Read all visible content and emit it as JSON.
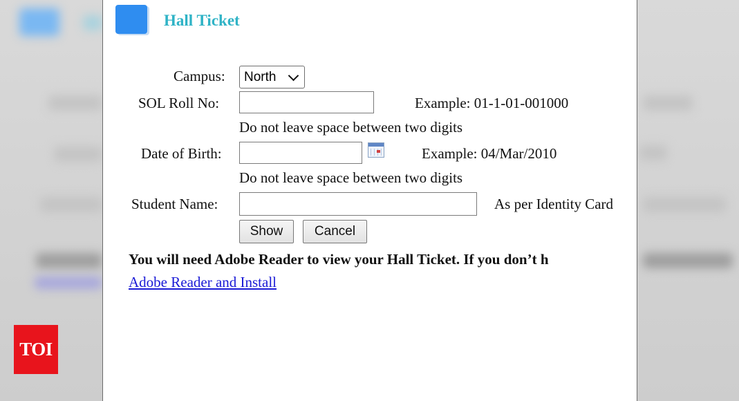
{
  "page": {
    "title": "Hall Ticket",
    "accent_color": "#2fb3c6",
    "icon_color": "#2f8df0"
  },
  "form": {
    "campus": {
      "label": "Campus:",
      "selected": "North"
    },
    "roll": {
      "label": "SOL Roll No:",
      "value": "",
      "example": "Example: 01-1-01-001000",
      "hint": "Do not leave space between two digits"
    },
    "dob": {
      "label": "Date of Birth:",
      "value": "",
      "example": "Example: 04/Mar/2010",
      "hint": "Do not leave space between two digits",
      "calendar_icon": "calendar-icon"
    },
    "name": {
      "label": "Student Name:",
      "value": "",
      "note": "As per Identity Card"
    },
    "buttons": {
      "show": "Show",
      "cancel": "Cancel"
    }
  },
  "notice": {
    "text": "You will need Adobe Reader to view your Hall Ticket. If you don’t h",
    "link": "Adobe Reader and Install"
  },
  "watermark": {
    "text": "TOI",
    "color": "#e8141c"
  }
}
